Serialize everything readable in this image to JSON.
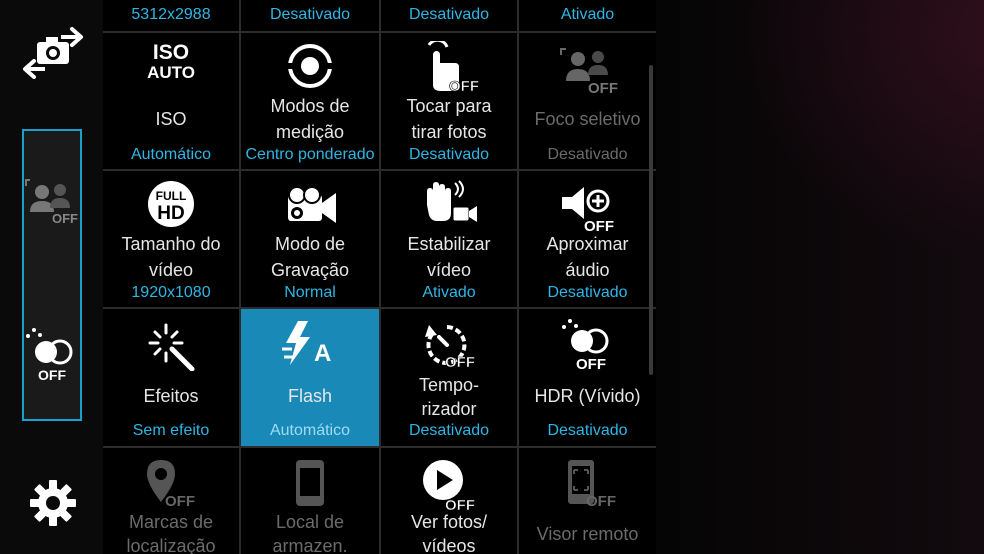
{
  "sidebar": {
    "switch_camera_icon": "camera-switch-icon",
    "shortcut_selective_focus_badge": "OFF",
    "shortcut_hdr_badge": "OFF",
    "settings_icon": "gear-icon",
    "accent": "#1aa0cc"
  },
  "grid": {
    "top_row": [
      {
        "value": "5312x2988"
      },
      {
        "value": "Desativado"
      },
      {
        "value": "Desativado"
      },
      {
        "value": "Ativado"
      }
    ],
    "row1": [
      {
        "icon": "iso-auto-icon",
        "icon_text": "ISO",
        "icon_subtext": "AUTO",
        "label": "ISO",
        "value": "Automático"
      },
      {
        "icon": "metering-icon",
        "label_l1": "Modos de",
        "label_l2": "medição",
        "value": "Centro ponderado"
      },
      {
        "icon": "touch-shot-icon",
        "badge": "OFF",
        "label_l1": "Tocar para",
        "label_l2": "tirar fotos",
        "value": "Desativado"
      },
      {
        "icon": "selective-focus-icon",
        "badge": "OFF",
        "label": "Foco seletivo",
        "value": "Desativado"
      }
    ],
    "row2": [
      {
        "icon": "full-hd-icon",
        "icon_text": "FULL",
        "icon_subtext": "HD",
        "label_l1": "Tamanho do",
        "label_l2": "vídeo",
        "value": "1920x1080"
      },
      {
        "icon": "video-camera-icon",
        "label_l1": "Modo de",
        "label_l2": "Gravação",
        "value": "Normal"
      },
      {
        "icon": "stabilize-icon",
        "label_l1": "Estabilizar",
        "label_l2": "vídeo",
        "value": "Ativado"
      },
      {
        "icon": "audio-zoom-icon",
        "badge": "OFF",
        "label_l1": "Aproximar",
        "label_l2": "áudio",
        "value": "Desativado"
      }
    ],
    "row3": [
      {
        "icon": "effects-wand-icon",
        "label": "Efeitos",
        "value": "Sem efeito"
      },
      {
        "icon": "flash-auto-icon",
        "icon_text": "A",
        "label": "Flash",
        "value": "Automático"
      },
      {
        "icon": "timer-icon",
        "badge": "OFF",
        "label_l1": "Tempo-",
        "label_l2": "rizador",
        "value": "Desativado"
      },
      {
        "icon": "hdr-icon",
        "badge": "OFF",
        "label": "HDR (Vívido)",
        "value": "Desativado"
      }
    ],
    "row4": [
      {
        "icon": "location-tag-icon",
        "badge": "OFF",
        "label_l1": "Marcas de",
        "label_l2": "localização"
      },
      {
        "icon": "storage-phone-icon",
        "label_l1": "Local de",
        "label_l2": "armazen."
      },
      {
        "icon": "review-play-icon",
        "badge": "OFF",
        "label_l1": "Ver fotos/",
        "label_l2": "vídeos"
      },
      {
        "icon": "remote-viewfinder-icon",
        "badge": "OFF",
        "label": "Visor remoto"
      }
    ],
    "selected_color": "#1989b8",
    "value_color": "#2fb6e4"
  }
}
